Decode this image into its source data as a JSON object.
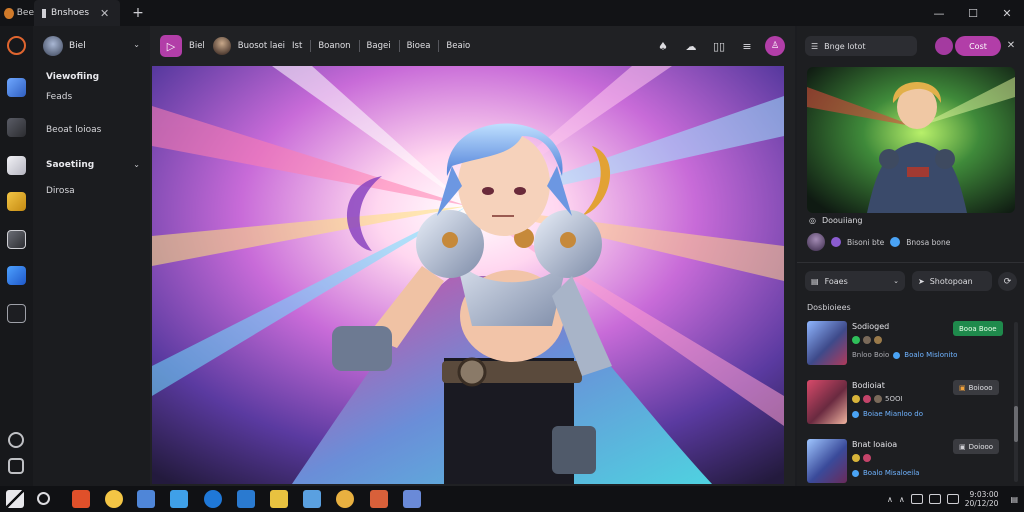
{
  "titlebar": {
    "app_label": "Bee",
    "tab_label": "Bnshoes",
    "window_controls": [
      "minimize-icon",
      "maximize-icon",
      "close-icon"
    ]
  },
  "sidebar": {
    "user_name": "Biel",
    "items": [
      {
        "label": "Viewofiing",
        "type": "head"
      },
      {
        "label": "Feads",
        "type": "item"
      },
      {
        "label": "Beoat loioas",
        "type": "item"
      },
      {
        "label": "Saoetiing",
        "type": "head"
      },
      {
        "label": "Dirosa",
        "type": "item"
      }
    ]
  },
  "main": {
    "toolbar": {
      "text1": "Biel",
      "text2": "Buosot laei",
      "text3": "Ist",
      "nav": [
        "Boanon",
        "Bagei",
        "Bioea",
        "Beaio"
      ]
    }
  },
  "right_panel": {
    "search_label": "Bnge lotot",
    "primary_button": "Cost",
    "preview_title": "Doouiiang",
    "meta1": "Bisoni bte",
    "meta2": "Bnosa bone",
    "select_label": "Foaes",
    "action_label": "Shotopoan",
    "section_label": "Dosbioiees",
    "rows": [
      {
        "name": "Sodioged",
        "dots_text": "",
        "status": "Boalo Mislonito",
        "sub": "Bnloo Boio",
        "badge": "Booa Booe",
        "badge_style": "green"
      },
      {
        "name": "Bodioiat",
        "dots_text": "5OOI",
        "status": "Boiae Mianloo do",
        "sub": "",
        "badge": "Boiooo",
        "badge_style": "gray"
      },
      {
        "name": "Bnat loaioa",
        "dots_text": "",
        "status": "Boalo Misaloeila",
        "sub": "",
        "badge": "Doiooo",
        "badge_style": "gray"
      }
    ]
  },
  "taskbar": {
    "clock_line1": "9:03:00",
    "clock_line2": "20/12/20"
  },
  "colors": {
    "accent": "#b23ea8",
    "badge_green": "#1f8a4c",
    "status_blue": "#6fb3ff"
  }
}
